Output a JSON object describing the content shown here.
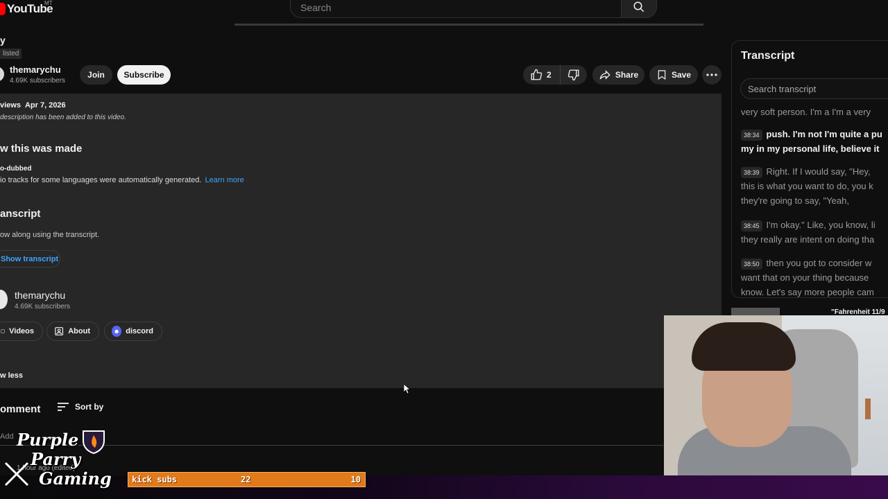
{
  "header": {
    "logo_text": "YouTube",
    "region": "MT",
    "search_placeholder": "Search"
  },
  "video": {
    "title_fragment": "y",
    "visibility": "listed"
  },
  "channel": {
    "name": "themarychu",
    "subscribers": "4.69K subscribers",
    "join_label": "Join",
    "subscribe_label": "Subscribe"
  },
  "actions": {
    "like_count": "2",
    "share_label": "Share",
    "save_label": "Save"
  },
  "description": {
    "views_fragment": "views",
    "date": "Apr 7, 2026",
    "no_description": "description has been added to this video.",
    "how_made_heading": "w this was made",
    "auto_dubbed_heading": "o-dubbed",
    "auto_dubbed_text": "io tracks for some languages were automatically generated.",
    "learn_more": "Learn more",
    "transcript_heading": "anscript",
    "transcript_text": "ow along using the transcript.",
    "show_transcript": "Show transcript",
    "channel_name": "themarychu",
    "channel_subs": "4.69K subscribers",
    "videos_label": "Videos",
    "about_label": "About",
    "discord_label": "discord",
    "show_less": "w less"
  },
  "comments": {
    "heading": "omment",
    "sort_label": "Sort by",
    "add_placeholder": "Add",
    "author_fragment": "1 hour ago (edited)"
  },
  "transcript_panel": {
    "title": "Transcript",
    "search_placeholder": "Search transcript",
    "segments": [
      {
        "time": "",
        "text": "very soft person. I'm a I'm a very",
        "active": false
      },
      {
        "time": "38:34",
        "text": "push. I'm not I'm quite a pu",
        "line2": "my in my personal life, believe it",
        "active": true
      },
      {
        "time": "38:39",
        "text": "Right. If I would say, \"Hey,",
        "line2": "this is what you want to do, you k",
        "line3": "they're going to say, \"Yeah,",
        "active": false
      },
      {
        "time": "38:45",
        "text": "I'm okay.\" Like, you know, li",
        "line2": "they really are intent on doing tha",
        "active": false
      },
      {
        "time": "38:50",
        "text": "then you got to consider w",
        "line2": "want that on your thing because",
        "line3": "know. Let's say more people cam",
        "active": false
      }
    ]
  },
  "recommendation": {
    "title": "\"Fahrenheit 11/9"
  },
  "overlay": {
    "logo_line1": "Purple",
    "logo_line2": "Parry",
    "logo_line3": "Gaming",
    "kick_label": "kick subs",
    "kick_count": "22",
    "kick_goal": "10",
    "accent_orange": "#e07a1a",
    "accent_purple": "#3a0b4a"
  }
}
